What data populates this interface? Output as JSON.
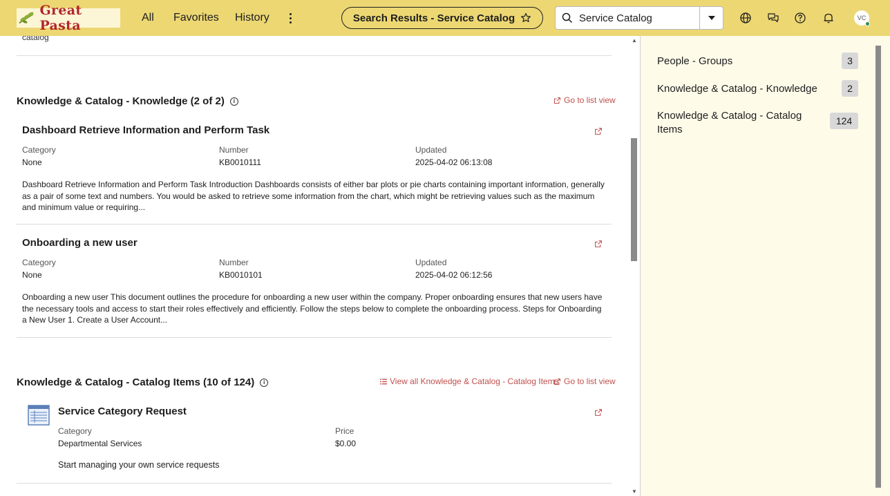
{
  "brand": {
    "name": "Great Pasta"
  },
  "nav": {
    "all": "All",
    "favorites": "Favorites",
    "history": "History"
  },
  "title_pill": {
    "label": "Search Results - Service Catalog"
  },
  "search": {
    "value": "Service Catalog"
  },
  "user": {
    "initials": "VC"
  },
  "main": {
    "clipped_text": "catalog",
    "knowledge": {
      "title": "Knowledge & Catalog - Knowledge (2 of 2)",
      "list_link": "Go to list view",
      "results": [
        {
          "title": "Dashboard Retrieve Information and Perform Task",
          "category_label": "Category",
          "category": "None",
          "number_label": "Number",
          "number": "KB0010111",
          "updated_label": "Updated",
          "updated": "2025-04-02 06:13:08",
          "snippet": "Dashboard Retrieve Information and Perform Task Introduction Dashboards consists of either bar plots or pie charts containing important information, generally as a pair of some text and numbers. You would be asked to retrieve some information from the chart, which might be retrieving values such as the maximum and minimum value or requiring..."
        },
        {
          "title": "Onboarding a new user",
          "category_label": "Category",
          "category": "None",
          "number_label": "Number",
          "number": "KB0010101",
          "updated_label": "Updated",
          "updated": "2025-04-02 06:12:56",
          "snippet": "Onboarding a new user This document outlines the procedure for onboarding a new user within the company. Proper onboarding ensures that new users have the necessary tools and access to start their roles effectively and efficiently. Follow the steps below to complete the onboarding process. Steps for Onboarding a New User 1. Create a User Account..."
        }
      ]
    },
    "catalog": {
      "title": "Knowledge & Catalog - Catalog Items (10 of 124)",
      "view_all_link": "View all Knowledge & Catalog - Catalog Items",
      "list_link": "Go to list view",
      "results": [
        {
          "title": "Service Category Request",
          "category_label": "Category",
          "category": "Departmental Services",
          "price_label": "Price",
          "price": "$0.00",
          "description": "Start managing your own service requests"
        }
      ]
    }
  },
  "sidebar": {
    "items": [
      {
        "label": "People - Groups",
        "count": "3"
      },
      {
        "label": "Knowledge & Catalog - Knowledge",
        "count": "2"
      },
      {
        "label": "Knowledge & Catalog - Catalog Items",
        "count": "124"
      }
    ]
  },
  "colors": {
    "topbar": "#ecd773",
    "link": "#c0504d",
    "sidebar_bg": "#fffbe9",
    "brand_red": "#b3262a"
  }
}
